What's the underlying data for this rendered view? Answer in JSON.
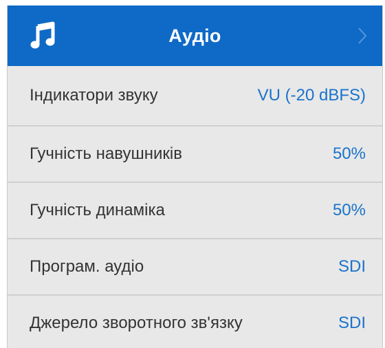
{
  "header": {
    "title": "Аудіо",
    "icon": "music-note-icon",
    "chevron_icon": "chevron-right-icon",
    "background_color": "#0e6ac6"
  },
  "settings": [
    {
      "label": "Індикатори звуку",
      "value": "VU (-20 dBFS)"
    },
    {
      "label": "Гучність навушників",
      "value": "50%"
    },
    {
      "label": "Гучність динаміка",
      "value": "50%"
    },
    {
      "label": "Програм. аудіо",
      "value": "SDI"
    },
    {
      "label": "Джерело зворотного зв'язку",
      "value": "SDI"
    }
  ],
  "colors": {
    "value_text": "#1a73cc",
    "label_text": "#333333",
    "panel_background": "#e8e8e8"
  }
}
